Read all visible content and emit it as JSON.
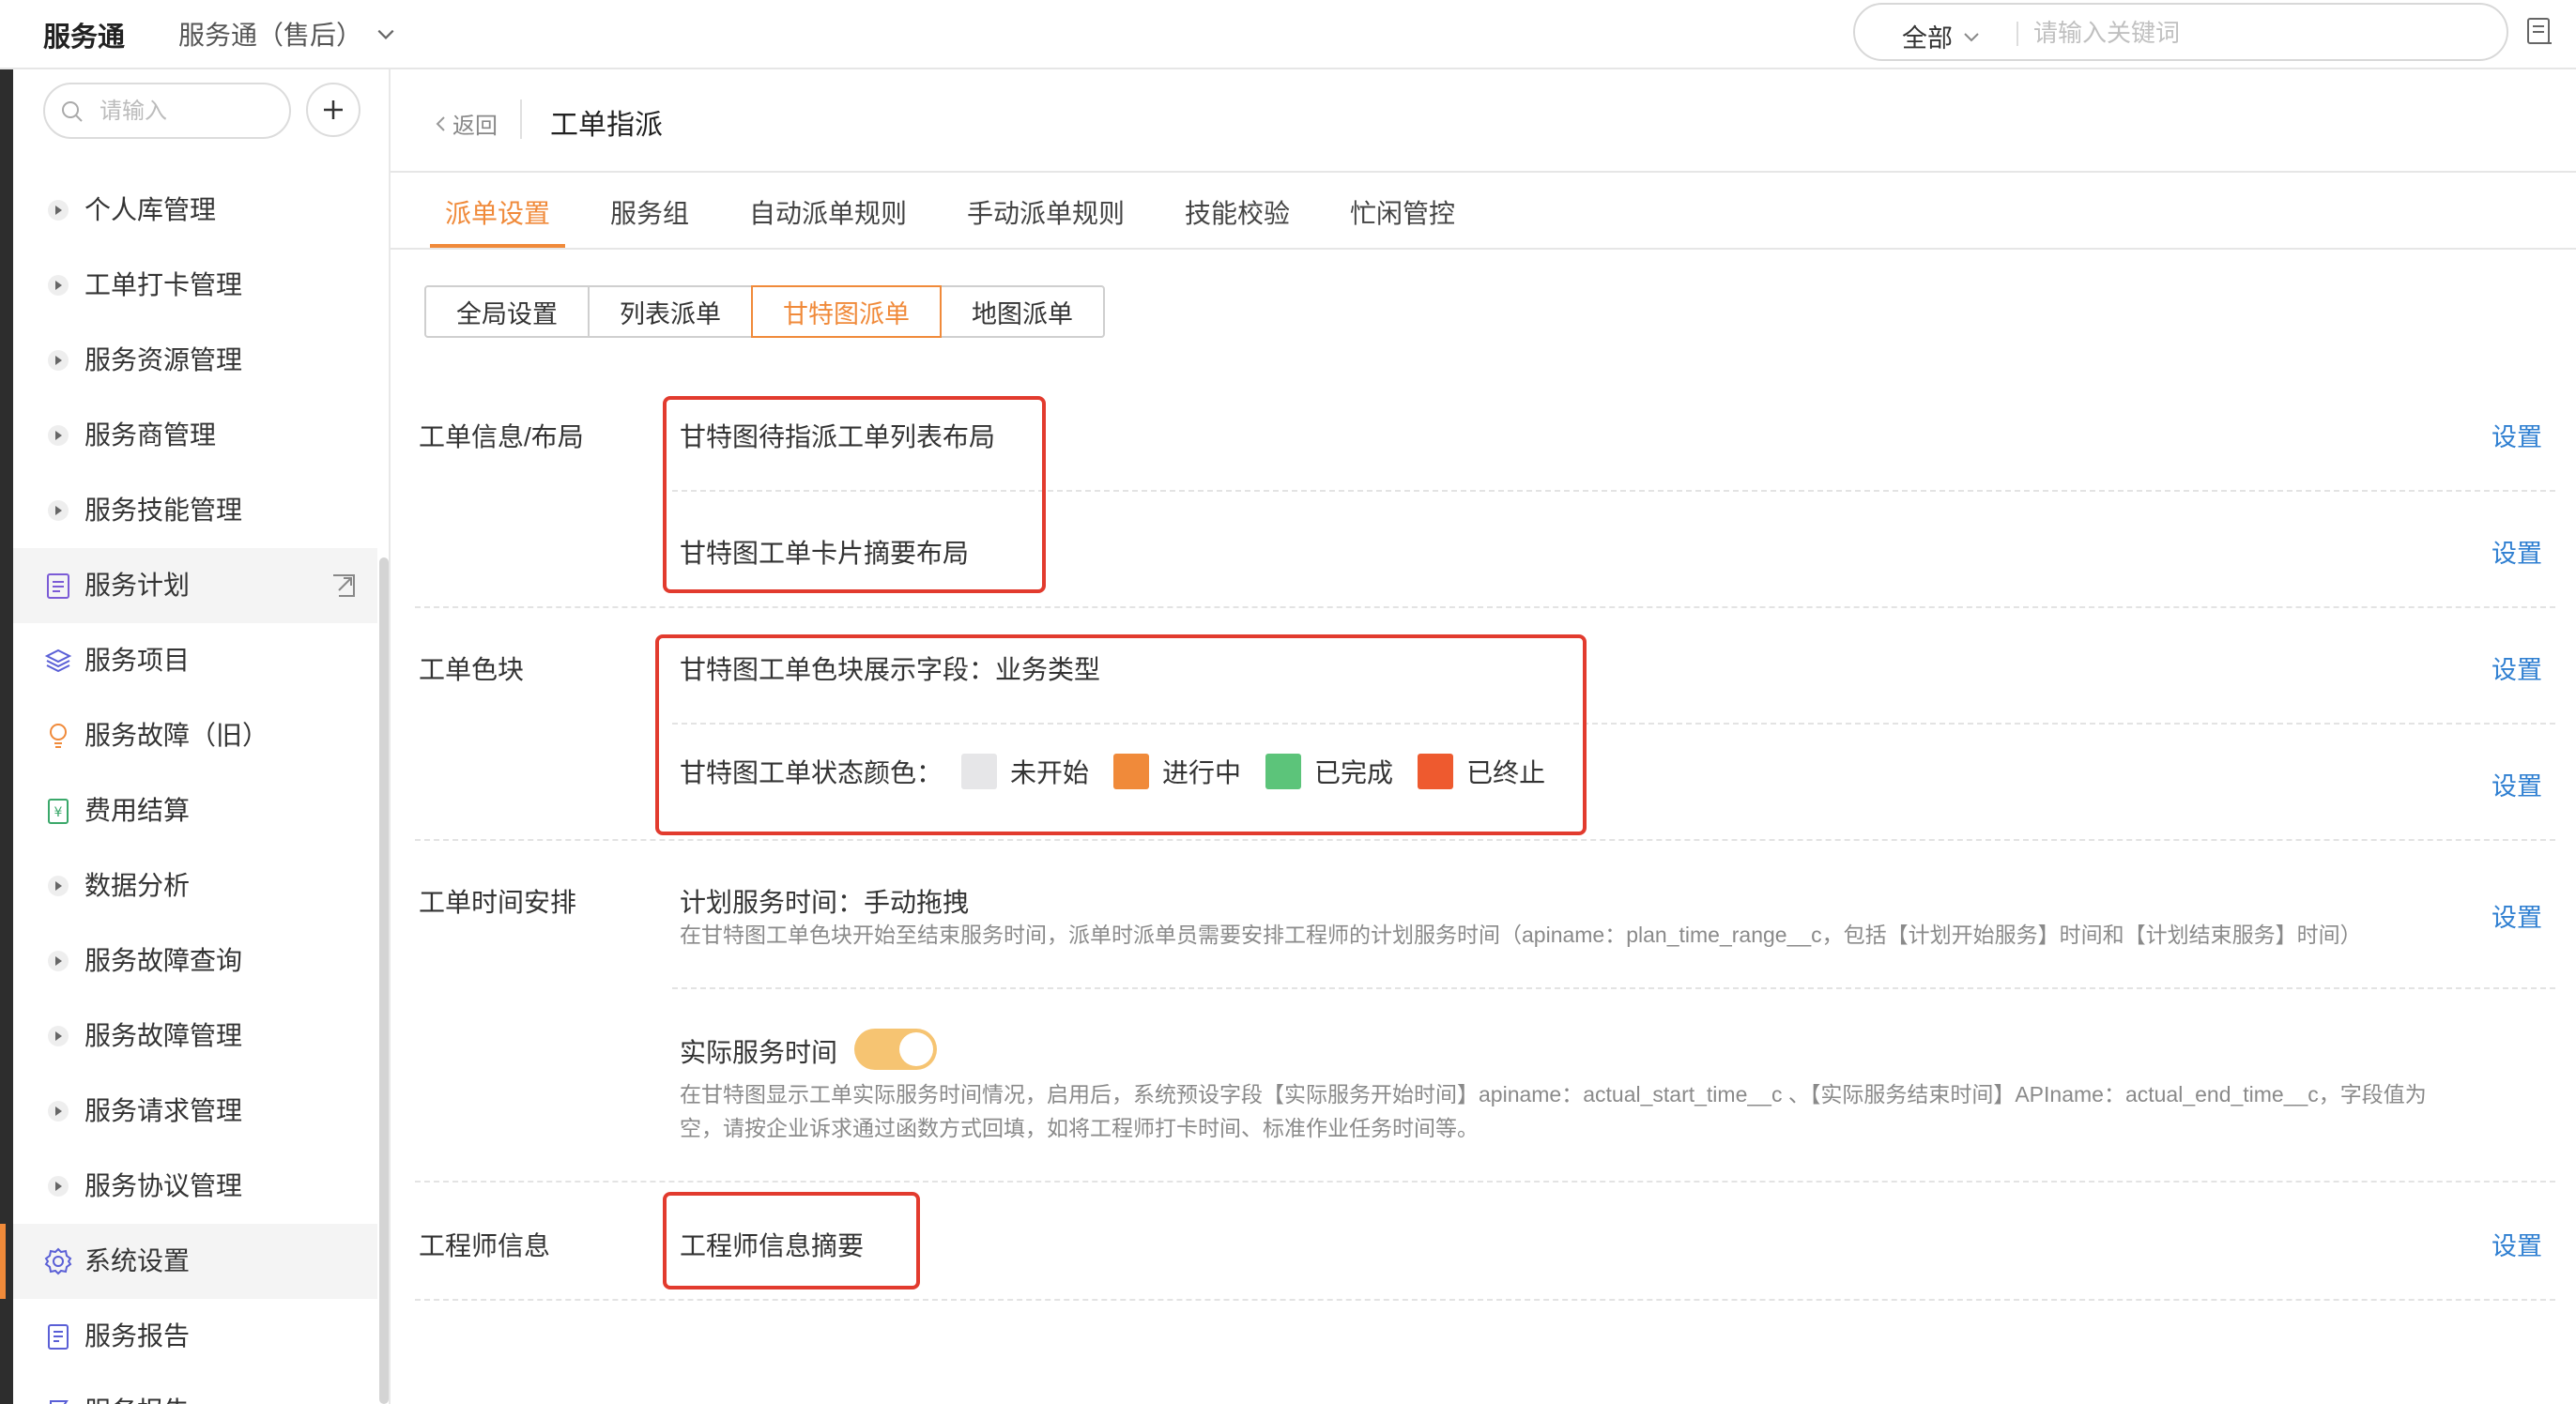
{
  "topbar": {
    "brand": "服务通",
    "app_switch": "服务通（售后）",
    "search_scope": "全部",
    "search_placeholder": "请输入关键词"
  },
  "sidebar": {
    "search_placeholder": "请输入",
    "items": [
      {
        "label": "个人库管理",
        "icon": "caret-right-icon"
      },
      {
        "label": "工单打卡管理",
        "icon": "caret-right-icon"
      },
      {
        "label": "服务资源管理",
        "icon": "caret-right-icon"
      },
      {
        "label": "服务商管理",
        "icon": "caret-right-icon"
      },
      {
        "label": "服务技能管理",
        "icon": "caret-right-icon"
      },
      {
        "label": "服务计划",
        "icon": "clipboard-icon"
      },
      {
        "label": "服务项目",
        "icon": "layers-icon"
      },
      {
        "label": "服务故障（旧）",
        "icon": "bulb-icon"
      },
      {
        "label": "费用结算",
        "icon": "receipt-icon"
      },
      {
        "label": "数据分析",
        "icon": "caret-right-icon"
      },
      {
        "label": "服务故障查询",
        "icon": "caret-right-icon"
      },
      {
        "label": "服务故障管理",
        "icon": "caret-right-icon"
      },
      {
        "label": "服务请求管理",
        "icon": "caret-right-icon"
      },
      {
        "label": "服务协议管理",
        "icon": "caret-right-icon"
      },
      {
        "label": "系统设置",
        "icon": "gear-icon"
      },
      {
        "label": "服务报告",
        "icon": "document-icon"
      },
      {
        "label": "服务报告",
        "icon": "flag-icon"
      }
    ]
  },
  "header": {
    "back_label": "返回",
    "title": "工单指派"
  },
  "tabs": [
    "派单设置",
    "服务组",
    "自动派单规则",
    "手动派单规则",
    "技能校验",
    "忙闲管控"
  ],
  "segments": [
    "全局设置",
    "列表派单",
    "甘特图派单",
    "地图派单"
  ],
  "sections": {
    "layout": {
      "label": "工单信息/布局",
      "row1": "甘特图待指派工单列表布局",
      "row2": "甘特图工单卡片摘要布局"
    },
    "color": {
      "label": "工单色块",
      "row1": "甘特图工单色块展示字段：业务类型",
      "row2_prefix": "甘特图工单状态颜色：",
      "statuses": [
        {
          "label": "未开始",
          "color": "#e6e6e8"
        },
        {
          "label": "进行中",
          "color": "#f08a3a"
        },
        {
          "label": "已完成",
          "color": "#5cc47a"
        },
        {
          "label": "已终止",
          "color": "#ee5a2f"
        }
      ]
    },
    "time": {
      "label": "工单时间安排",
      "row1": "计划服务时间：手动拖拽",
      "row1_desc": "在甘特图工单色块开始至结束服务时间，派单时派单员需要安排工程师的计划服务时间（apiname：plan_time_range__c，包括【计划开始服务】时间和【计划结束服务】时间）",
      "row2": "实际服务时间",
      "row2_toggle_on": true,
      "row2_desc_line1": "在甘特图显示工单实际服务时间情况，启用后，系统预设字段【实际服务开始时间】apiname：actual_start_time__c 、【实际服务结束时间】APIname：actual_end_time__c，字段值为",
      "row2_desc_line2": "空，请按企业诉求通过函数方式回填，如将工程师打卡时间、标准作业任务时间等。"
    },
    "engineer": {
      "label": "工程师信息",
      "row1": "工程师信息摘要"
    }
  },
  "set_label": "设置",
  "colors": {
    "accent": "#f08a3a",
    "link": "#2f7fd1",
    "highlight": "#e23b2e"
  }
}
